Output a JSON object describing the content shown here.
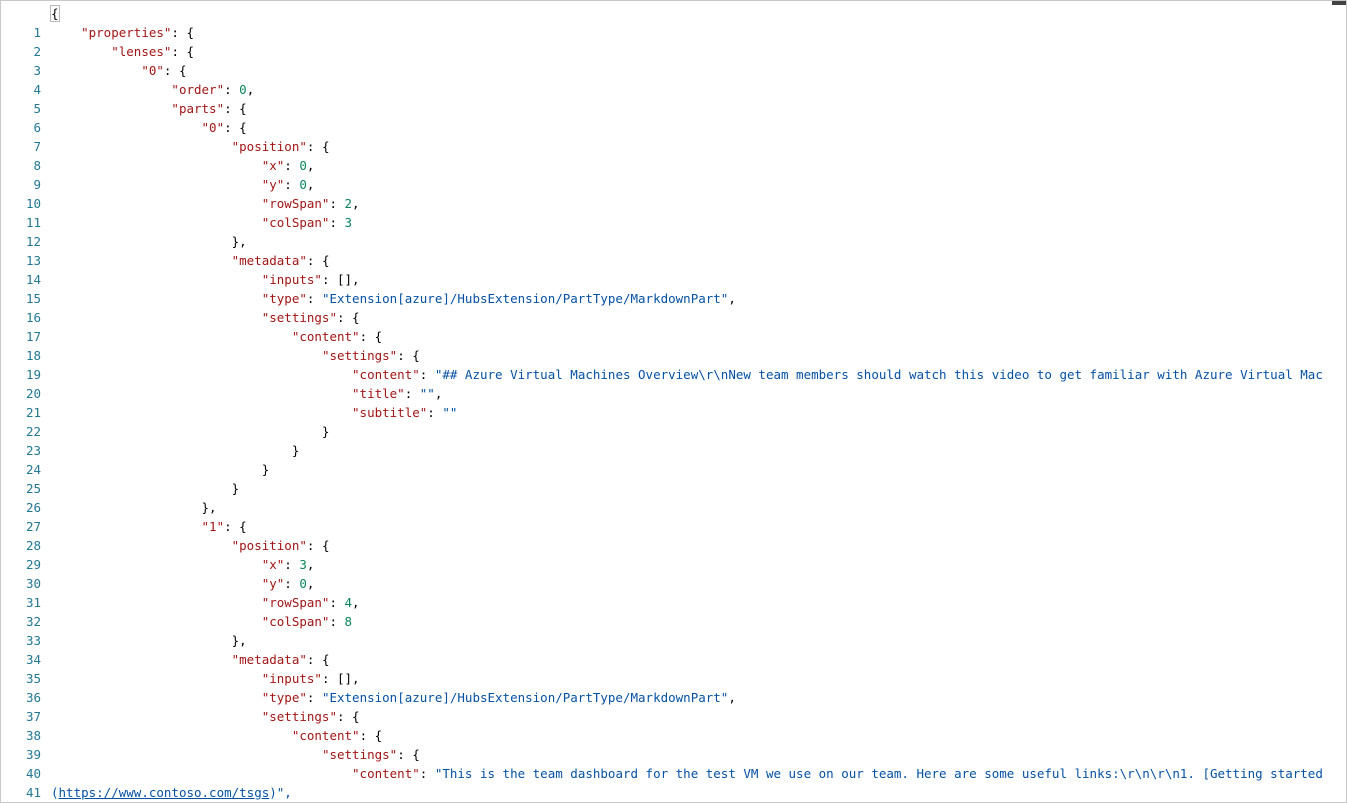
{
  "editor": {
    "line_numbers": [
      "1",
      "2",
      "3",
      "4",
      "5",
      "6",
      "7",
      "8",
      "9",
      "10",
      "11",
      "12",
      "13",
      "14",
      "15",
      "16",
      "17",
      "18",
      "19",
      "20",
      "21",
      "22",
      "23",
      "24",
      "25",
      "26",
      "27",
      "28",
      "29",
      "30",
      "31",
      "32",
      "33",
      "34",
      "35",
      "36",
      "37",
      "38",
      "39",
      "40",
      "41"
    ],
    "tokens": {
      "l1_brace": "{",
      "l2_key": "\"properties\"",
      "l3_key": "\"lenses\"",
      "l4_key": "\"0\"",
      "l5_key": "\"order\"",
      "l5_val": "0",
      "l6_key": "\"parts\"",
      "l7_key": "\"0\"",
      "l8_key": "\"position\"",
      "l9_key": "\"x\"",
      "l9_val": "0",
      "l10_key": "\"y\"",
      "l10_val": "0",
      "l11_key": "\"rowSpan\"",
      "l11_val": "2",
      "l12_key": "\"colSpan\"",
      "l12_val": "3",
      "l14_key": "\"metadata\"",
      "l15_key": "\"inputs\"",
      "l16_key": "\"type\"",
      "l16_val": "\"Extension[azure]/HubsExtension/PartType/MarkdownPart\"",
      "l17_key": "\"settings\"",
      "l18_key": "\"content\"",
      "l19_key": "\"settings\"",
      "l20_key": "\"content\"",
      "l20_val": "\"## Azure Virtual Machines Overview\\r\\nNew team members should watch this video to get familiar with Azure Virtual Mac",
      "l21_key": "\"title\"",
      "l21_val": "\"\"",
      "l22_key": "\"subtitle\"",
      "l22_val": "\"\"",
      "l28_key": "\"1\"",
      "l29_key": "\"position\"",
      "l30_key": "\"x\"",
      "l30_val": "3",
      "l31_key": "\"y\"",
      "l31_val": "0",
      "l32_key": "\"rowSpan\"",
      "l32_val": "4",
      "l33_key": "\"colSpan\"",
      "l33_val": "8",
      "l35_key": "\"metadata\"",
      "l36_key": "\"inputs\"",
      "l37_key": "\"type\"",
      "l37_val": "\"Extension[azure]/HubsExtension/PartType/MarkdownPart\"",
      "l38_key": "\"settings\"",
      "l39_key": "\"content\"",
      "l40_key": "\"settings\"",
      "l41_key": "\"content\"",
      "l41_val": "\"This is the team dashboard for the test VM we use on our team. Here are some useful links:\\r\\n\\r\\n1. [Getting started",
      "wrap_open": "(",
      "wrap_link": "https://www.contoso.com/tsgs",
      "wrap_close": ")\","
    }
  },
  "colors": {
    "key": "#a31515",
    "string": "#0451a5",
    "number": "#098658",
    "line_number": "#237893"
  }
}
